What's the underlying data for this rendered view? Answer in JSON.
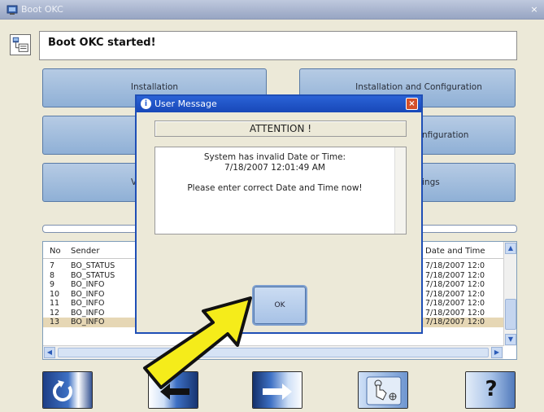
{
  "window": {
    "title": "Boot OKC",
    "close_glyph": "×"
  },
  "status": {
    "icon": "computer-status-icon",
    "text": "Boot OKC started!"
  },
  "menu": {
    "installation": "Installation",
    "installation_and_configuration": "Installation and Configuration",
    "row2_right_visible": "nfiguration",
    "row3_left_visible": "V",
    "row3_right_visible": "ings"
  },
  "log": {
    "headers": {
      "no": "No",
      "sender": "Sender",
      "date": "Date and Time"
    },
    "rows": [
      {
        "no": "7",
        "sender": "BO_STATUS",
        "date": "7/18/2007 12:0"
      },
      {
        "no": "8",
        "sender": "BO_STATUS",
        "date": "7/18/2007 12:0"
      },
      {
        "no": "9",
        "sender": "BO_INFO",
        "date": "7/18/2007 12:0"
      },
      {
        "no": "10",
        "sender": "BO_INFO",
        "date": "7/18/2007 12:0"
      },
      {
        "no": "11",
        "sender": "BO_INFO",
        "date": "7/18/2007 12:0"
      },
      {
        "no": "12",
        "sender": "BO_INFO",
        "date": "7/18/2007 12:0"
      },
      {
        "no": "13",
        "sender": "BO_INFO",
        "date": "7/18/2007 12:0"
      }
    ],
    "selected_row": "13"
  },
  "toolbar": {
    "buttons": [
      "refresh-icon",
      "arrow-left-icon",
      "arrow-right-icon",
      "touch-hand-icon",
      "help-icon"
    ],
    "help_label": "?"
  },
  "dialog": {
    "title": "User Message",
    "info_glyph": "i",
    "close_glyph": "×",
    "heading": "ATTENTION !",
    "line1": "System has invalid Date or Time:",
    "line2": "7/18/2007 12:01:49 AM",
    "line3": "Please enter correct Date and Time now!",
    "ok_label": "OK"
  },
  "colors": {
    "button_blue": "#a6c0e0",
    "dialog_title": "#1f4fb6",
    "arrow_yellow": "#f5ec1a",
    "selected_row": "#e6d7b5"
  }
}
